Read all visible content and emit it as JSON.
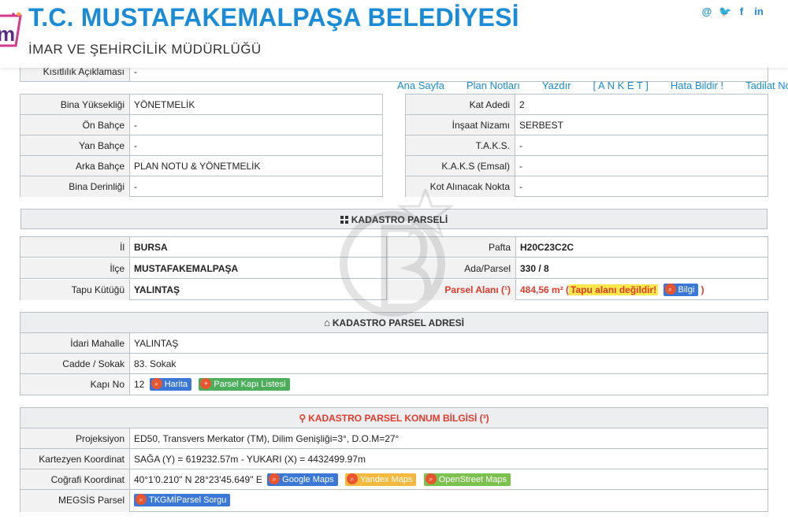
{
  "header": {
    "title": "T.C. MUSTAFAKEMALPAŞA BELEDİYESİ",
    "subtitle": "İMAR VE ŞEHİRCİLİK MÜDÜRLÜĞÜ",
    "social": [
      "@",
      "🐦",
      "f",
      "in"
    ]
  },
  "kisitlilik": {
    "label": "Kısıtlılık Açıklaması",
    "value": "-"
  },
  "nav": [
    "Ana Sayfa",
    "Plan Notları",
    "Yazdır",
    "[ A N K E T ]",
    "Hata Bildir !",
    "Tadilat No"
  ],
  "left_table": [
    {
      "label": "Bina Yüksekliği",
      "value": "YÖNETMELİK"
    },
    {
      "label": "Ön Bahçe",
      "value": "-"
    },
    {
      "label": "Yan Bahçe",
      "value": "-"
    },
    {
      "label": "Arka Bahçe",
      "value": "PLAN NOTU & YÖNETMELİK"
    },
    {
      "label": "Bina Derinliği",
      "value": "-"
    }
  ],
  "right_table": [
    {
      "label": "Kat Adedi",
      "value": "2"
    },
    {
      "label": "İnşaat Nizamı",
      "value": "SERBEST"
    },
    {
      "label": "T.A.K.S.",
      "value": "-"
    },
    {
      "label": "K.A.K.S (Emsal)",
      "value": "-"
    },
    {
      "label": "Kot Alınacak Nokta",
      "value": "-"
    }
  ],
  "kadastro": {
    "title": "KADASTRO PARSELİ",
    "il_label": "İl",
    "il": "BURSA",
    "ilce_label": "İlçe",
    "ilce": "MUSTAFAKEMALPAŞA",
    "tapu_label": "Tapu Kütüğü",
    "tapu": "YALINTAŞ",
    "pafta_label": "Pafta",
    "pafta": "H20C23C2C",
    "ada_label": "Ada/Parsel",
    "ada": "330 / 8",
    "alan_label": "Parsel Alanı (¹)",
    "alan": "484,56 m²",
    "alan_note_open": "(",
    "alan_note": "Tapu alanı değildir!",
    "bilgi": "Bilgi",
    "alan_note_close": ")"
  },
  "adres": {
    "title": "KADASTRO PARSEL ADRESİ",
    "mahalle_label": "İdari Mahalle",
    "mahalle": "YALINTAŞ",
    "cadde_label": "Cadde / Sokak",
    "cadde": "83. Sokak",
    "kapi_label": "Kapı No",
    "kapi": "12",
    "harita": "Harita",
    "kapi_listesi": "Parsel Kapı Listesi"
  },
  "konum": {
    "title": "KADASTRO PARSEL KONUM BİLGİSİ (³)",
    "proj_label": "Projeksiyon",
    "proj": "ED50, Transvers Merkator (TM), Dilim Genişliği=3°, D.O.M=27°",
    "kartezyen_label": "Kartezyen Koordinat",
    "kartezyen": "SAĞA (Y) = 619232.57m - YUKARI (X) = 4432499.97m",
    "cografi_label": "Coğrafi Koordinat",
    "cografi": "40°1'0.210\" N 28°23'45.649\" E",
    "google": "Google Maps",
    "yandex": "Yandex Maps",
    "osm": "OpenStreet Maps",
    "megsis_label": "MEGSİS Parsel",
    "megsis": "TKGMİParsel Sorgu"
  },
  "colors": {
    "brand": "#1a8bd6",
    "alert": "#e23b2e",
    "highlight": "#ffe94a",
    "border": "#b9c0c6"
  }
}
